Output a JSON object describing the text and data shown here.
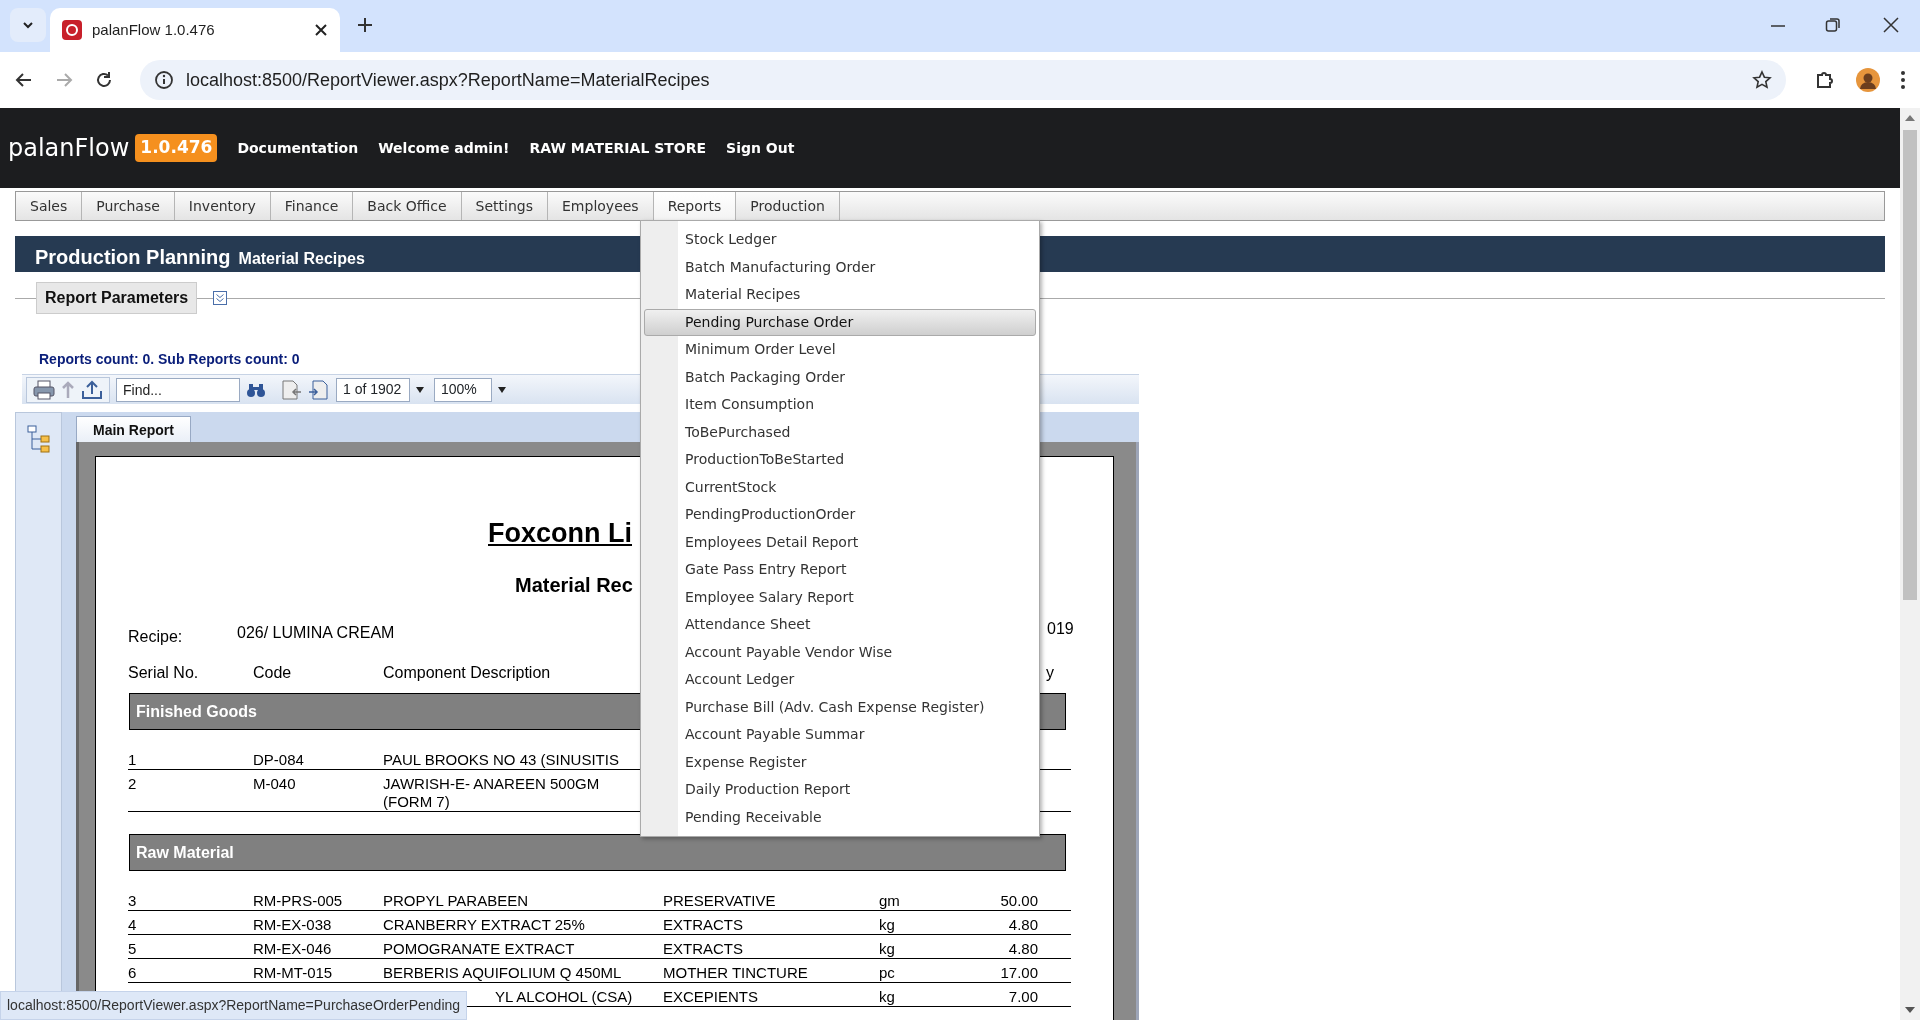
{
  "browser": {
    "tab_title": "palanFlow 1.0.476",
    "url": "localhost:8500/ReportViewer.aspx?ReportName=MaterialRecipes",
    "status_url": "localhost:8500/ReportViewer.aspx?ReportName=PurchaseOrderPending"
  },
  "app": {
    "logo": "palanFlow",
    "version": "1.0.476",
    "nav_links": [
      "Documentation",
      "Welcome admin!",
      "RAW MATERIAL STORE",
      "Sign Out"
    ]
  },
  "menu": [
    {
      "label": "Sales",
      "open": false
    },
    {
      "label": "Purchase",
      "open": false
    },
    {
      "label": "Inventory",
      "open": false
    },
    {
      "label": "Finance",
      "open": false
    },
    {
      "label": "Back Office",
      "open": false
    },
    {
      "label": "Settings",
      "open": false
    },
    {
      "label": "Employees",
      "open": false
    },
    {
      "label": "Reports",
      "open": true
    },
    {
      "label": "Production",
      "open": false
    }
  ],
  "reports_menu": [
    {
      "label": "Stock Ledger",
      "selected": false
    },
    {
      "label": "Batch Manufacturing Order",
      "selected": false
    },
    {
      "label": "Material Recipes",
      "selected": false
    },
    {
      "label": "Pending Purchase Order",
      "selected": true
    },
    {
      "label": "Minimum Order Level",
      "selected": false
    },
    {
      "label": "Batch Packaging Order",
      "selected": false
    },
    {
      "label": "Item Consumption",
      "selected": false
    },
    {
      "label": "ToBePurchased",
      "selected": false
    },
    {
      "label": "ProductionToBeStarted",
      "selected": false
    },
    {
      "label": "CurrentStock",
      "selected": false
    },
    {
      "label": "PendingProductionOrder",
      "selected": false
    },
    {
      "label": "Employees Detail Report",
      "selected": false
    },
    {
      "label": "Gate Pass Entry Report",
      "selected": false
    },
    {
      "label": "Employee Salary Report",
      "selected": false
    },
    {
      "label": "Attendance Sheet",
      "selected": false
    },
    {
      "label": "Account Payable Vendor Wise",
      "selected": false
    },
    {
      "label": "Account Ledger",
      "selected": false
    },
    {
      "label": "Purchase Bill (Adv. Cash Expense Register)",
      "selected": false
    },
    {
      "label": "Account Payable Summar",
      "selected": false
    },
    {
      "label": "Expense Register",
      "selected": false
    },
    {
      "label": "Daily Production Report",
      "selected": false
    },
    {
      "label": "Pending Receivable",
      "selected": false
    }
  ],
  "page_header": {
    "title": "Production Planning",
    "subtitle": "Material Recipes"
  },
  "report_parameters": {
    "label": "Report Parameters"
  },
  "reports_count": "Reports count: 0. Sub Reports count: 0",
  "viewer": {
    "find_placeholder": "Find...",
    "page": "1 of 1902",
    "zoom": "100%",
    "tab": "Main Report"
  },
  "report": {
    "company": "Foxconn Li",
    "title": "Material Rec",
    "date_fragment": "019",
    "recipe_label": "Recipe:",
    "recipe_value": "026/ LUMINA CREAM",
    "columns": [
      "Serial No.",
      "Code",
      "Component Description",
      "",
      "",
      "y"
    ],
    "sections": [
      {
        "title": "Finished Goods",
        "rows": [
          {
            "cells": [
              "1",
              "DP-084",
              "PAUL BROOKS NO 43 (SINUSITIS",
              "",
              "",
              ""
            ]
          },
          {
            "cells": [
              "2",
              "M-040",
              "JAWRISH-E- ANAREEN 500GM (FORM 7)",
              "",
              "",
              ""
            ]
          }
        ]
      },
      {
        "title": "Raw Material",
        "rows": [
          {
            "cells": [
              "3",
              "RM-PRS-005",
              "PROPYL PARABEEN",
              "PRESERVATIVE",
              "gm",
              "50.00"
            ]
          },
          {
            "cells": [
              "4",
              "RM-EX-038",
              "CRANBERRY EXTRACT 25%",
              "EXTRACTS",
              "kg",
              "4.80"
            ]
          },
          {
            "cells": [
              "5",
              "RM-EX-046",
              "POMOGRANATE EXTRACT",
              "EXTRACTS",
              "kg",
              "4.80"
            ]
          },
          {
            "cells": [
              "6",
              "RM-MT-015",
              "BERBERIS AQUIFOLIUM Q 450ML",
              "MOTHER TINCTURE",
              "pc",
              "17.00"
            ]
          },
          {
            "cells": [
              "",
              "",
              "YL ALCOHOL (CSA)",
              "EXCEPIENTS",
              "kg",
              "7.00"
            ]
          }
        ]
      }
    ]
  }
}
